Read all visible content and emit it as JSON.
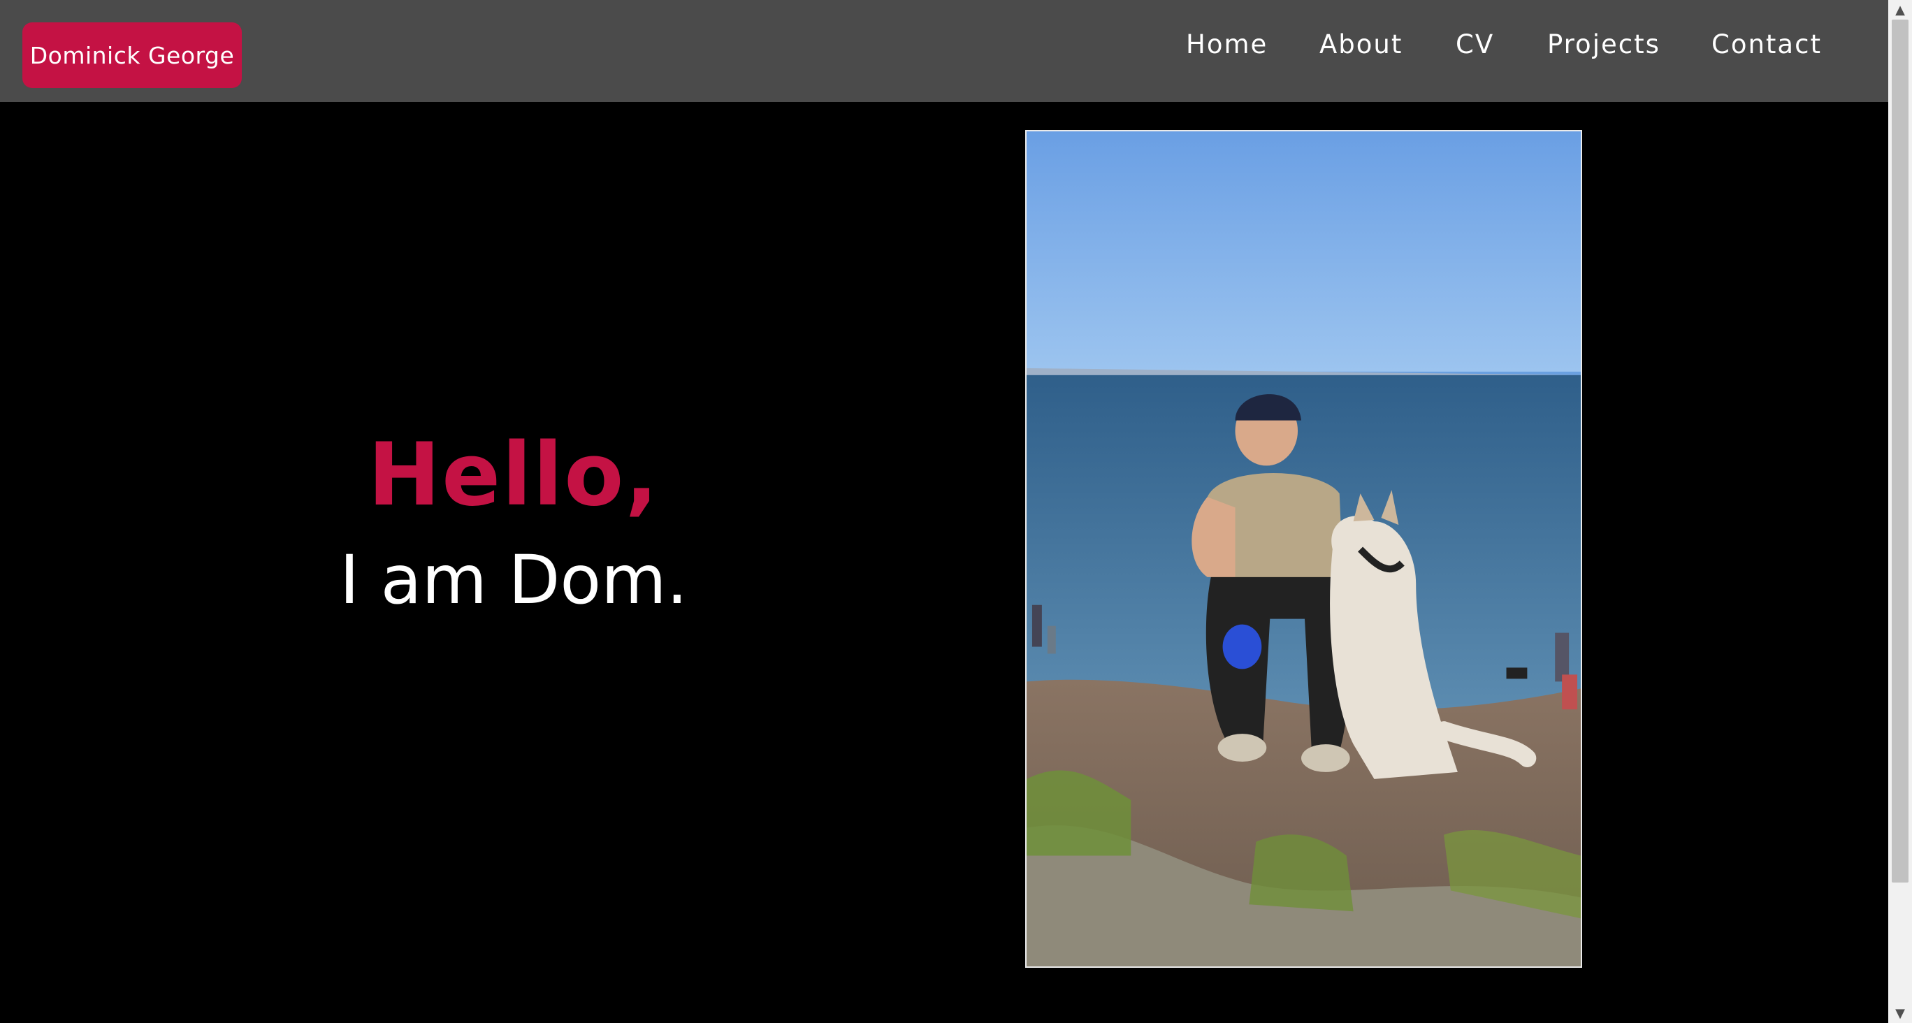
{
  "header": {
    "brand": "Dominick George",
    "nav": [
      {
        "label": "Home"
      },
      {
        "label": "About"
      },
      {
        "label": "CV"
      },
      {
        "label": "Projects"
      },
      {
        "label": "Contact"
      }
    ]
  },
  "hero": {
    "greeting": "Hello,",
    "intro": "I am Dom.",
    "photo_icon": "profile-photo"
  },
  "colors": {
    "accent": "#c41244",
    "header_bg": "#4b4b4b",
    "page_bg": "#000000",
    "text": "#ffffff"
  }
}
